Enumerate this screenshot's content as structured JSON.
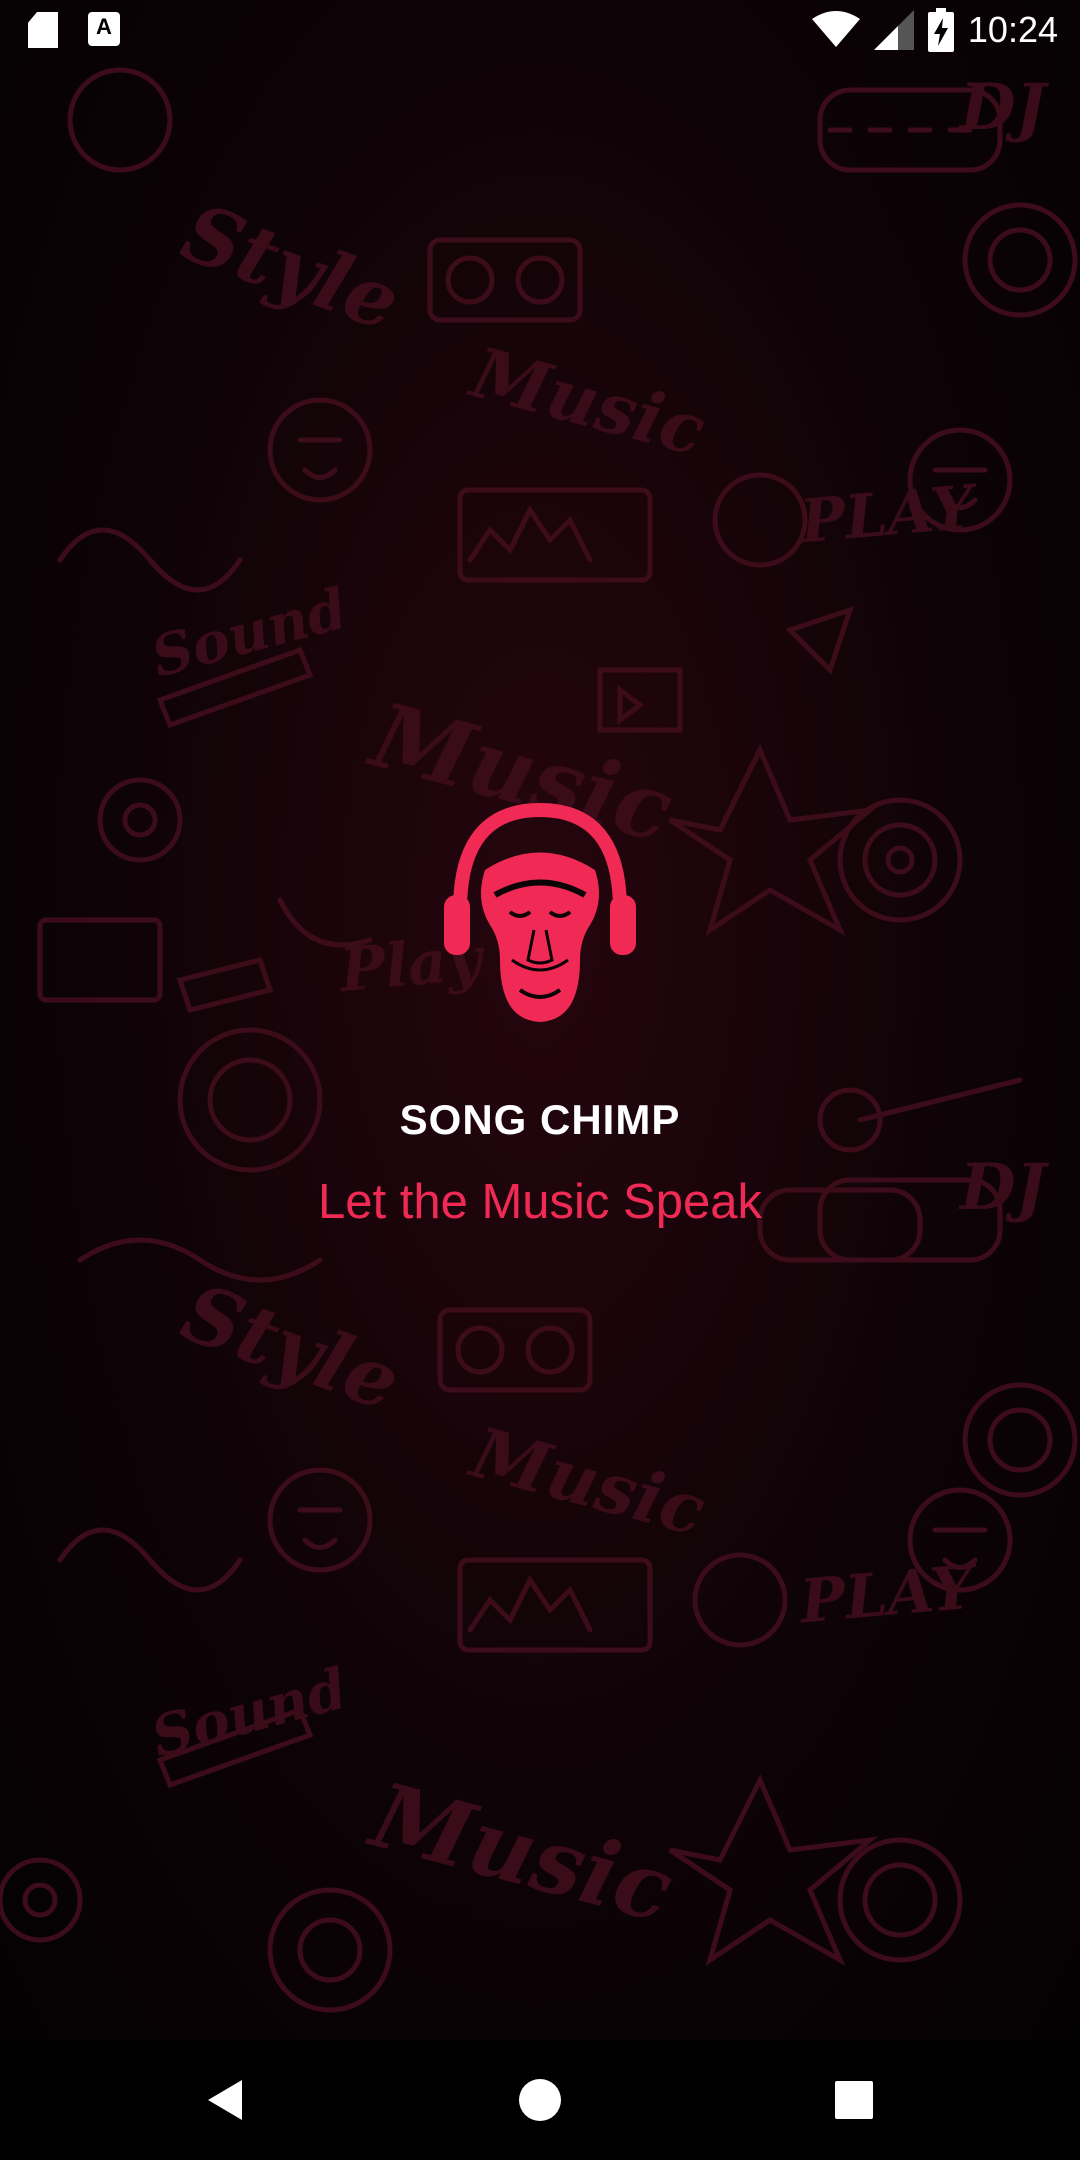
{
  "status_bar": {
    "time": "10:24",
    "icons": [
      "sd-card-icon",
      "text-a-icon",
      "wifi-icon",
      "signal-icon",
      "battery-charging-icon"
    ],
    "a_icon_glyph": "A"
  },
  "splash": {
    "app_name": "SONG CHIMP",
    "tagline": "Let the Music Speak",
    "logo": "monkey-headphones-logo"
  },
  "colors": {
    "accent": "#f02a55",
    "background": "#0b0306",
    "doodle": "#3a0b18",
    "title": "#ffffff"
  },
  "background_doodles": [
    "Music",
    "Style",
    "Sound",
    "PLAY",
    "Play",
    "DJ"
  ],
  "nav_bar": {
    "buttons": [
      "back-icon",
      "home-icon",
      "recents-icon"
    ]
  }
}
